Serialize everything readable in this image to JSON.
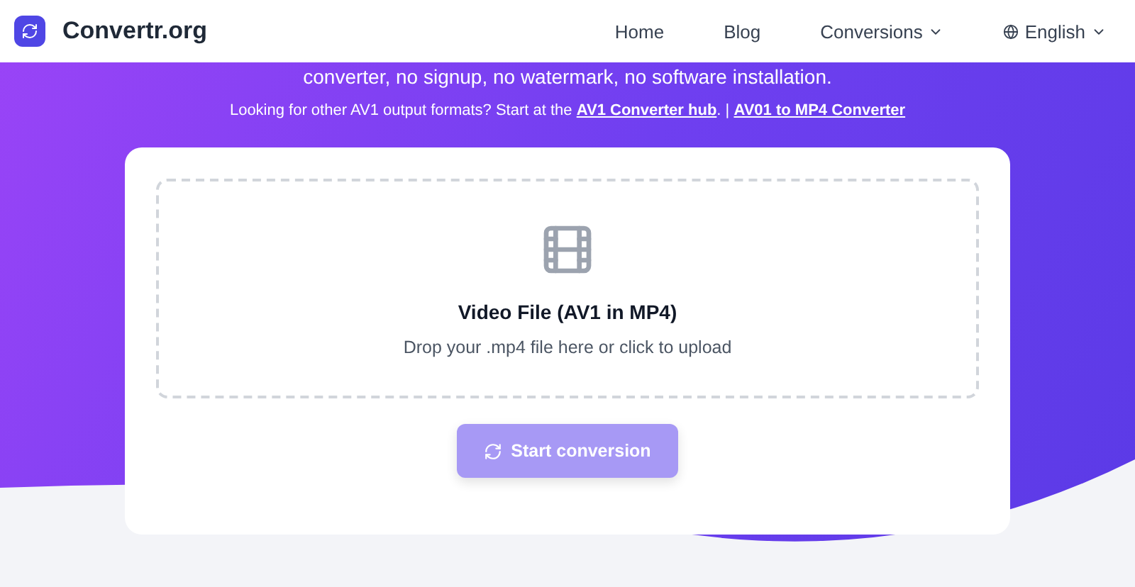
{
  "header": {
    "logo_text": "Convertr.org",
    "nav": [
      {
        "label": "Home",
        "kind": "link"
      },
      {
        "label": "Blog",
        "kind": "link"
      },
      {
        "label": "Conversions",
        "kind": "dropdown"
      },
      {
        "label": "English",
        "kind": "language"
      }
    ]
  },
  "hero": {
    "tagline": "converter, no signup, no watermark, no software installation.",
    "links_intro": "Looking for other AV1 output formats? Start at the",
    "links": [
      "AV1 Converter hub",
      "AV01 to MP4 Converter"
    ],
    "period": ".",
    "separator": "|"
  },
  "upload": {
    "title": "Video File (AV1 in MP4)",
    "hint": "Drop your .mp4 file here or click to upload"
  },
  "start_button": {
    "label": "Start conversion",
    "disabled": true
  }
}
